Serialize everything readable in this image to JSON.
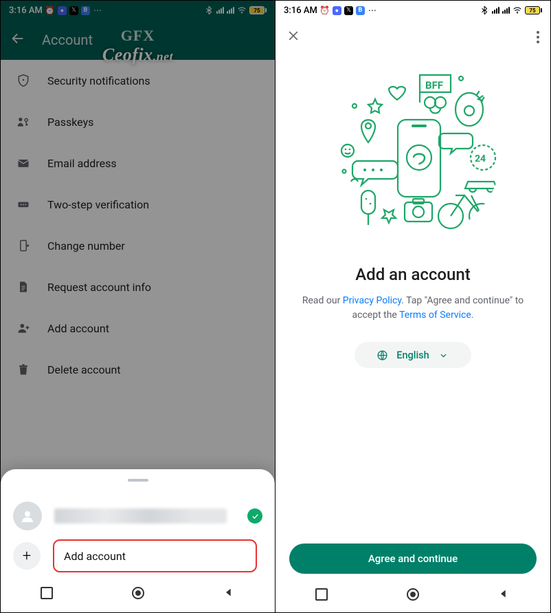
{
  "status": {
    "time": "3:16 AM",
    "battery_label": "75"
  },
  "left": {
    "title": "Account",
    "items": [
      {
        "label": "Security notifications"
      },
      {
        "label": "Passkeys"
      },
      {
        "label": "Email address"
      },
      {
        "label": "Two-step verification"
      },
      {
        "label": "Change number"
      },
      {
        "label": "Request account info"
      },
      {
        "label": "Add account"
      },
      {
        "label": "Delete account"
      }
    ],
    "sheet": {
      "add_label": "Add account"
    }
  },
  "right": {
    "title": "Add an account",
    "sub_prefix": "Read our ",
    "privacy": "Privacy Policy",
    "sub_mid": ". Tap \"Agree and continue\" to accept the ",
    "terms": "Terms of Service",
    "sub_suffix": ".",
    "language": "English",
    "agree_label": "Agree and continue"
  },
  "watermark": {
    "brand_top": "GFX",
    "brand": "Ceofix",
    "brand_suffix": ".net"
  }
}
